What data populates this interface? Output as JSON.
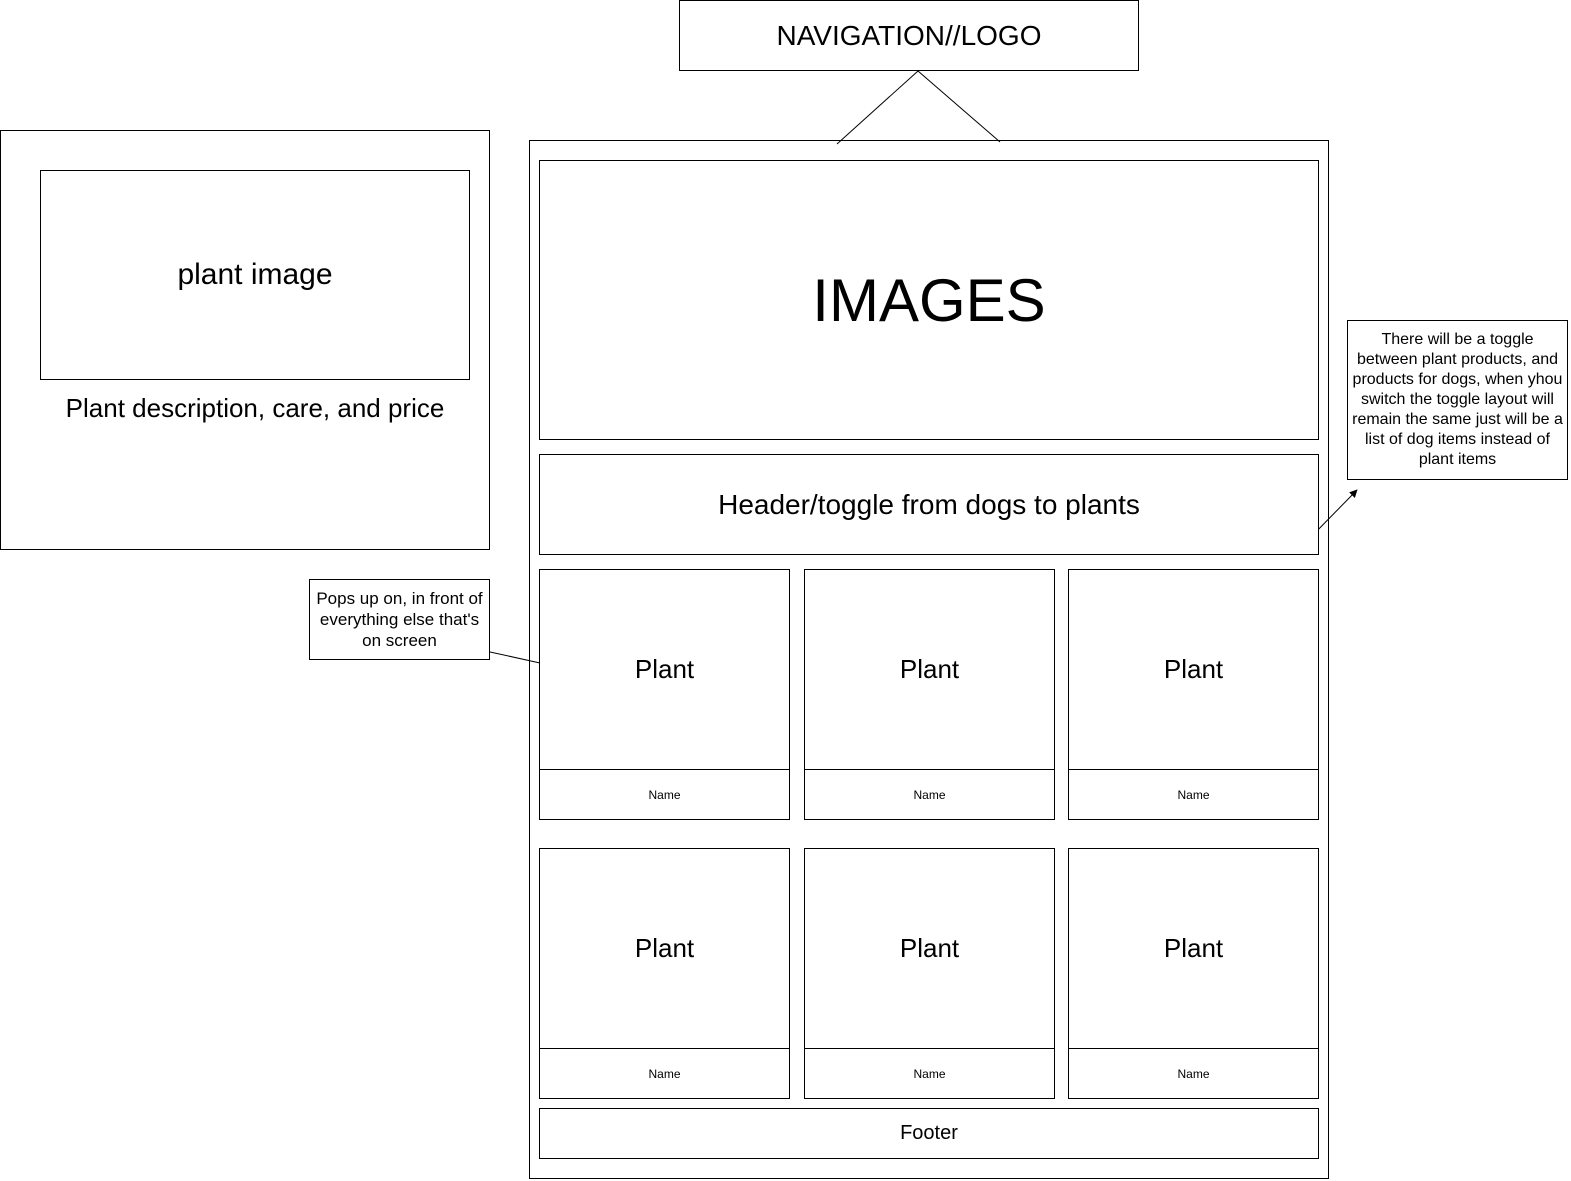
{
  "navigation": {
    "label": "NAVIGATION//LOGO"
  },
  "hero": {
    "label": "IMAGES"
  },
  "header": {
    "label": "Header/toggle from dogs to plants"
  },
  "cards": [
    {
      "image_label": "Plant",
      "name_label": "Name"
    },
    {
      "image_label": "Plant",
      "name_label": "Name"
    },
    {
      "image_label": "Plant",
      "name_label": "Name"
    },
    {
      "image_label": "Plant",
      "name_label": "Name"
    },
    {
      "image_label": "Plant",
      "name_label": "Name"
    },
    {
      "image_label": "Plant",
      "name_label": "Name"
    }
  ],
  "footer": {
    "label": "Footer"
  },
  "modal": {
    "image_label": "plant image",
    "description": "Plant description, care, and price",
    "close_icon": "close-icon"
  },
  "notes": {
    "popup": "Pops up on, in front of everything else that's on screen",
    "toggle": "There will be a toggle between plant products, and products for dogs, when yhou switch the toggle layout will remain the same just will be a list of dog items instead of plant items"
  },
  "colors": {
    "stroke": "#000000",
    "background": "#ffffff"
  }
}
